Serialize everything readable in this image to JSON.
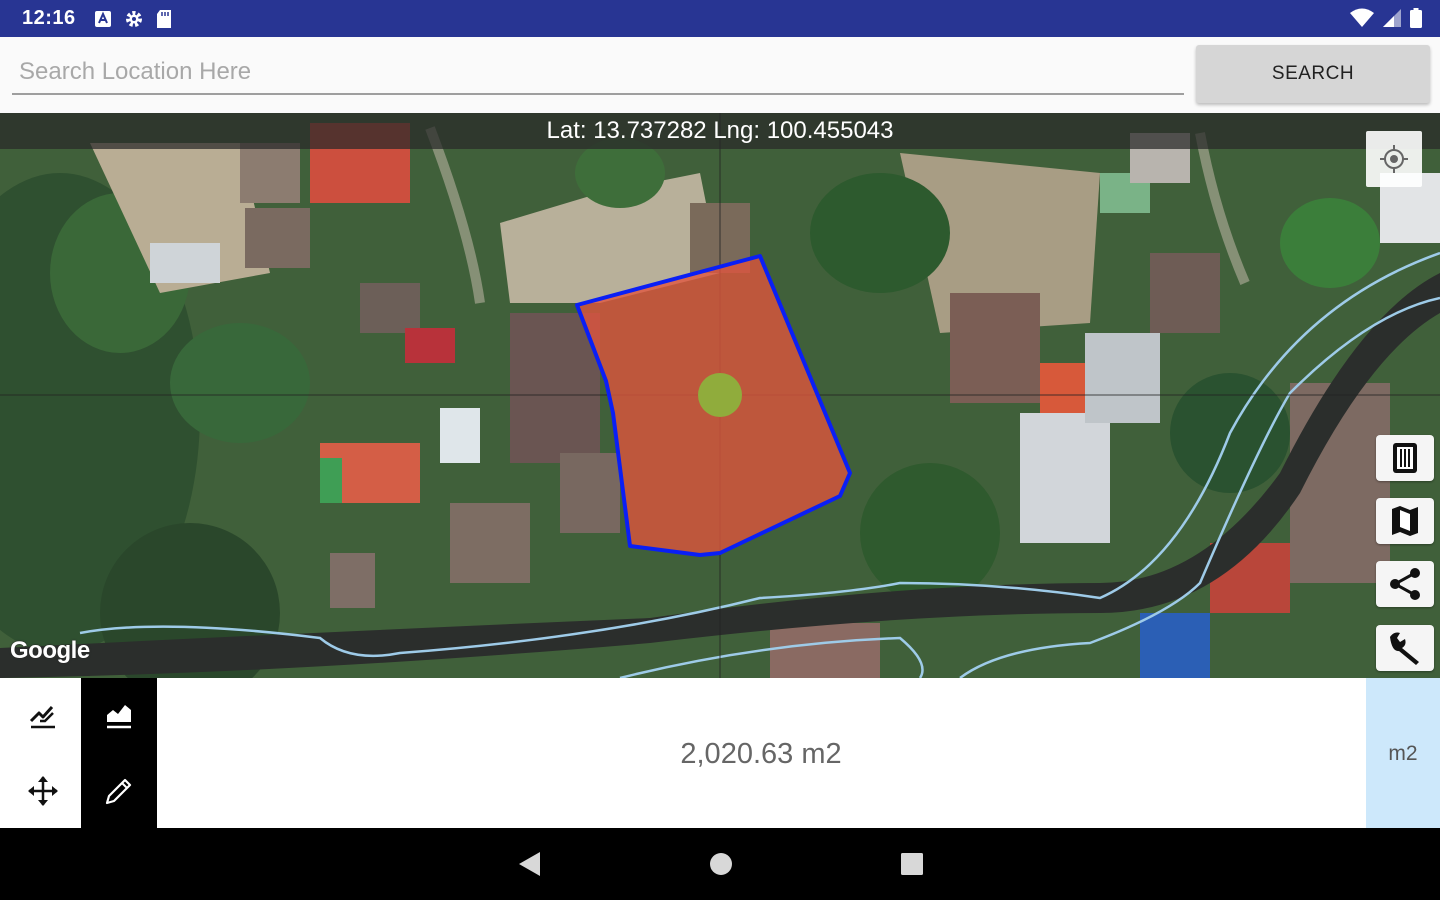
{
  "status_bar": {
    "time": "12:16",
    "left_icons": [
      "notification-icon",
      "settings-icon",
      "sd-card-icon"
    ],
    "right_icons": [
      "wifi-icon",
      "signal-icon",
      "battery-icon"
    ],
    "background": "#283593"
  },
  "search": {
    "placeholder": "Search Location Here",
    "value": "",
    "button_label": "SEARCH"
  },
  "map": {
    "coordinates_text": "Lat: 13.737282 Lng: 100.455043",
    "attribution": "Google",
    "polygon_stroke": "#0a1ff5",
    "polygon_fill": "#e2553e",
    "center_marker_color": "#8db13c",
    "controls": [
      "my-location-icon",
      "delete-icon",
      "map-layers-icon",
      "share-icon",
      "settings-wrench-icon"
    ]
  },
  "mode_tools": {
    "items": [
      {
        "name": "distance-mode",
        "icon": "line-chart-icon",
        "selected": false
      },
      {
        "name": "area-mode",
        "icon": "area-chart-icon",
        "selected": true
      },
      {
        "name": "move-mode",
        "icon": "move-icon",
        "selected": false
      },
      {
        "name": "draw-mode",
        "icon": "pencil-icon",
        "selected": true
      }
    ]
  },
  "measurement": {
    "value": "2,020.63 m2",
    "unit": "m2",
    "unit_background": "#cde8fb"
  },
  "nav_bar": {
    "buttons": [
      "back-icon",
      "home-icon",
      "recents-icon"
    ]
  }
}
